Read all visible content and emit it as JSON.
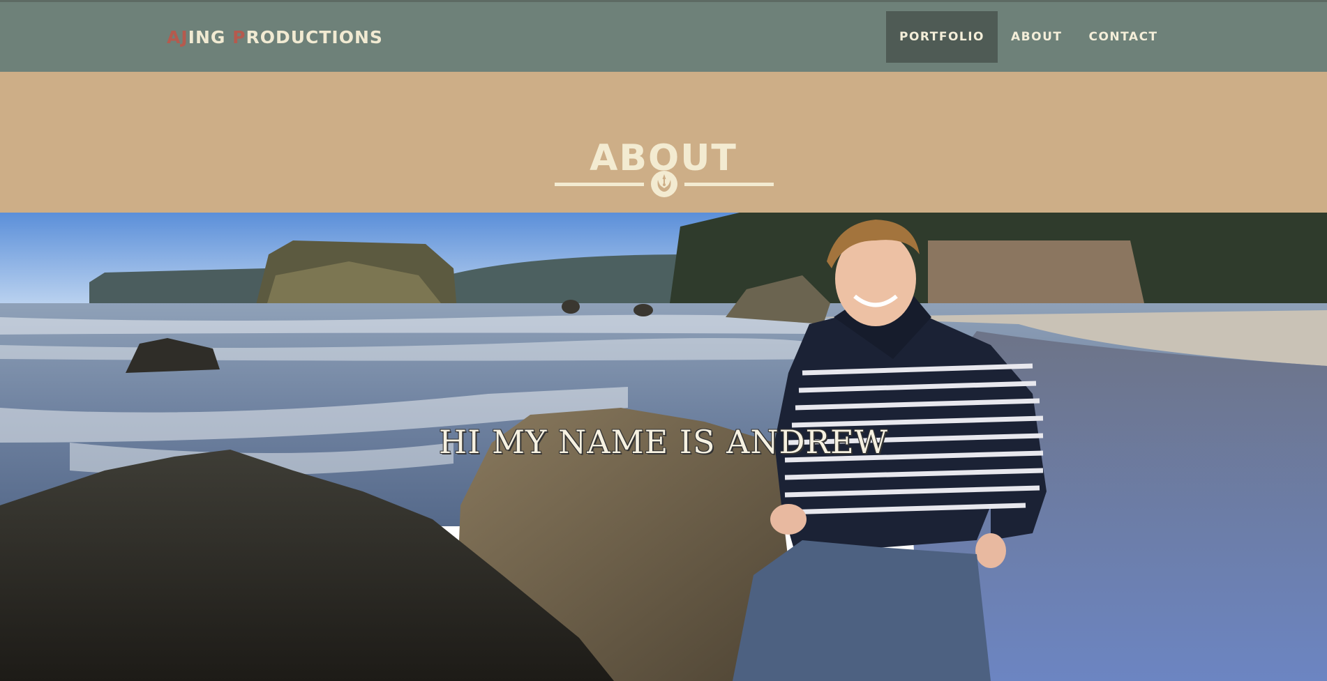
{
  "brand": {
    "part1_accent": "AJ",
    "part1_rest": "ING ",
    "part2_accent": "P",
    "part2_rest": "RODUCTIONS"
  },
  "nav": {
    "items": [
      {
        "label": "PORTFOLIO",
        "active": true
      },
      {
        "label": "ABOUT",
        "active": false
      },
      {
        "label": "CONTACT",
        "active": false
      }
    ]
  },
  "about": {
    "title": "ABOUT",
    "emblem_icon": "rebel-alliance-icon"
  },
  "hero": {
    "headline": "HI MY NAME IS ANDREW"
  },
  "colors": {
    "navbar": "#6e8179",
    "nav_active": "#4f5b55",
    "band": "#cdae87",
    "cream": "#f3ebd1",
    "accent": "#b55a4e"
  }
}
